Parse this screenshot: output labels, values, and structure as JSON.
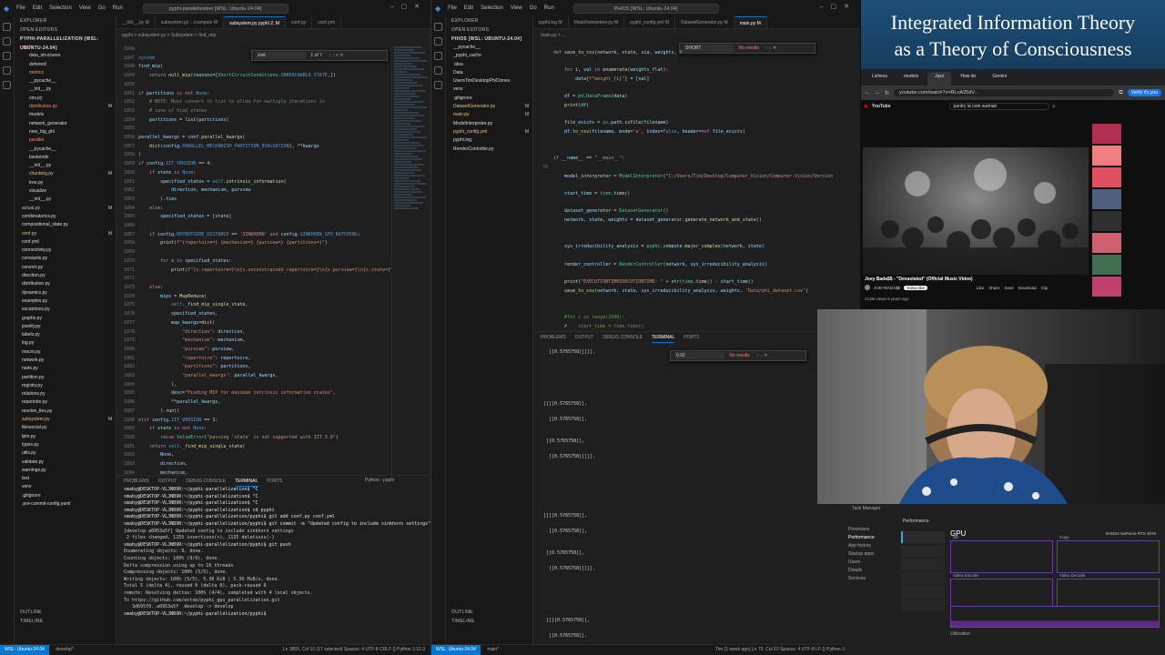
{
  "left_vscode": {
    "menu": [
      "File",
      "Edit",
      "Selection",
      "View",
      "Go",
      "Run"
    ],
    "command_center": "pyphi-parallelization [WSL: Ubuntu-24.04]",
    "explorer_title": "EXPLORER",
    "open_editors": "OPEN EDITORS",
    "root": "PYPHI-PARALLELIZATION [WSL: UBUNTU-24.04]",
    "tree": [
      {
        "name": "pyphi",
        "status": "",
        "cls": "red"
      },
      {
        "name": "data_structures",
        "status": "",
        "cls": ""
      },
      {
        "name": "deferred",
        "status": "",
        "cls": ""
      },
      {
        "name": "metrics",
        "status": "",
        "cls": "red"
      },
      {
        "name": "__pycache__",
        "status": "",
        "cls": ""
      },
      {
        "name": "__init__.py",
        "status": "",
        "cls": ""
      },
      {
        "name": "ces.py",
        "status": "",
        "cls": ""
      },
      {
        "name": "distribution.py",
        "status": "M",
        "cls": "red"
      },
      {
        "name": "models",
        "status": "",
        "cls": ""
      },
      {
        "name": "network_generator",
        "status": "",
        "cls": ""
      },
      {
        "name": "new_big_phi",
        "status": "",
        "cls": ""
      },
      {
        "name": "parallel",
        "status": "",
        "cls": "red"
      },
      {
        "name": "__pycache__",
        "status": "",
        "cls": ""
      },
      {
        "name": "backends",
        "status": "",
        "cls": ""
      },
      {
        "name": "__init__.py",
        "status": "",
        "cls": ""
      },
      {
        "name": "chunking.py",
        "status": "M",
        "cls": "mod"
      },
      {
        "name": "tree.py",
        "status": "",
        "cls": ""
      },
      {
        "name": "visualize",
        "status": "",
        "cls": ""
      },
      {
        "name": "__init__.py",
        "status": "",
        "cls": ""
      },
      {
        "name": "actual.py",
        "status": "M",
        "cls": "mod"
      },
      {
        "name": "combinatorics.py",
        "status": "",
        "cls": ""
      },
      {
        "name": "compositional_state.py",
        "status": "",
        "cls": ""
      },
      {
        "name": "conf.py",
        "status": "M",
        "cls": "mod"
      },
      {
        "name": "conf.yml",
        "status": "",
        "cls": ""
      },
      {
        "name": "connectivity.py",
        "status": "",
        "cls": ""
      },
      {
        "name": "constants.py",
        "status": "",
        "cls": ""
      },
      {
        "name": "convert.py",
        "status": "",
        "cls": ""
      },
      {
        "name": "direction.py",
        "status": "",
        "cls": ""
      },
      {
        "name": "distribution.py",
        "status": "",
        "cls": ""
      },
      {
        "name": "dynamics.py",
        "status": "",
        "cls": ""
      },
      {
        "name": "examples.py",
        "status": "",
        "cls": ""
      },
      {
        "name": "exceptions.py",
        "status": "",
        "cls": ""
      },
      {
        "name": "graphs.py",
        "status": "",
        "cls": ""
      },
      {
        "name": "jsonify.py",
        "status": "",
        "cls": ""
      },
      {
        "name": "labels.py",
        "status": "",
        "cls": ""
      },
      {
        "name": "log.py",
        "status": "",
        "cls": ""
      },
      {
        "name": "macro.py",
        "status": "",
        "cls": ""
      },
      {
        "name": "network.py",
        "status": "",
        "cls": ""
      },
      {
        "name": "node.py",
        "status": "",
        "cls": ""
      },
      {
        "name": "partition.py",
        "status": "",
        "cls": ""
      },
      {
        "name": "registry.py",
        "status": "",
        "cls": ""
      },
      {
        "name": "relations.py",
        "status": "",
        "cls": ""
      },
      {
        "name": "repertoire.py",
        "status": "",
        "cls": ""
      },
      {
        "name": "resolve_ties.py",
        "status": "",
        "cls": ""
      },
      {
        "name": "subsystem.py",
        "status": "M",
        "cls": "mod"
      },
      {
        "name": "tbinsocial.py",
        "status": "",
        "cls": ""
      },
      {
        "name": "tpm.py",
        "status": "",
        "cls": ""
      },
      {
        "name": "types.py",
        "status": "",
        "cls": ""
      },
      {
        "name": "utils.py",
        "status": "",
        "cls": ""
      },
      {
        "name": "validate.py",
        "status": "",
        "cls": ""
      },
      {
        "name": "warnings.py",
        "status": "",
        "cls": ""
      },
      {
        "name": "test",
        "status": "",
        "cls": ""
      },
      {
        "name": "venv",
        "status": "",
        "cls": ""
      },
      {
        "name": ".gitignore",
        "status": "",
        "cls": ""
      },
      {
        "name": ".pre-commit-config.yaml",
        "status": "",
        "cls": ""
      }
    ],
    "outline": "OUTLINE",
    "timeline": "TIMELINE",
    "tabs": [
      "__init__.py M",
      "subsystem.py ...\\compute M",
      "subsystem.py pyphi 2, M",
      "conf.py",
      "conf.yml"
    ],
    "breadcrumb": "pyphi > subsystem.py > Subsystem > find_mip",
    "find": {
      "query": "sink",
      "result": "1 of 7"
    },
    "line_numbers": [
      "1846",
      "1847",
      "1848",
      "1849",
      "1850",
      "1851",
      "1852",
      "1853",
      "1854",
      "1855",
      "1856",
      "1857",
      "1858",
      "1859",
      "1860",
      "1861",
      "1862",
      "1863",
      "1864",
      "1865",
      "1866",
      "1867",
      "1868",
      "1869",
      "1870",
      "1871",
      "1872",
      "1873",
      "1874",
      "1875",
      "1876",
      "1877",
      "1878",
      "1879",
      "1880",
      "1881",
      "1882",
      "1883",
      "1884",
      "1885",
      "1886",
      "1887",
      "1888",
      "1889",
      "1890",
      "1891",
      "1892",
      "1893",
      "1894"
    ],
    "panel_tabs": [
      "PROBLEMS",
      "OUTPUT",
      "DEBUG CONSOLE",
      "TERMINAL",
      "PORTS"
    ],
    "terminal_label": "Python - pyphi",
    "terminal_lines": [
      "smaby@DESKTOP-VLJNB9R:~/pyphi-parallelization$ ^C",
      "smaby@DESKTOP-VLJNB9R:~/pyphi-parallelization$ ^C",
      "smaby@DESKTOP-VLJNB9R:~/pyphi-parallelization$ ^C",
      "smaby@DESKTOP-VLJNB9R:~/pyphi-parallelization$ cd pyphi",
      "smaby@DESKTOP-VLJNB9R:~/pyphi-parallelization/pyphi$ git add conf.py conf.yml",
      "smaby@DESKTOP-VLJNB9R:~/pyphi-parallelization/pyphi$ git commit -m \"Updated config to include sinkhorn settings\"",
      "[develop a0953a5f] Updated config to include sinkhorn settings",
      " 2 files changed, 1255 insertions(+), 1135 deletions(-)",
      "smaby@DESKTOP-VLJNB9R:~/pyphi-parallelization/pyphi$ git push",
      "Enumerating objects: 9, done.",
      "Counting objects: 100% (9/9), done.",
      "Delta compression using up to 16 threads",
      "Compressing objects: 100% (5/5), done.",
      "Writing objects: 100% (5/5), 5.36 KiB | 5.36 MiB/s, done.",
      "Total 5 (delta 4), reused 0 (delta 0), pack-reused 0",
      "remote: Resolving deltas: 100% (4/4), completed with 4 local objects.",
      "To https://github.com/ectsm/pyphi_gpu_parallelization.git",
      "   3d695f0..a0953a5f  develop -> develop",
      "smaby@DESKTOP-VLJNB9R:~/pyphi-parallelization/pyphi$ "
    ],
    "status": {
      "remote": "WSL: Ubuntu-24.04",
      "branch": "develop*",
      "right": "Ln 1855, Col 10 (17 selected)   Spaces: 4   UTF-8   CRLF   {} Python   3.12.3"
    }
  },
  "right_vscode": {
    "menu": [
      "File",
      "Edit",
      "Selection",
      "View",
      "Go",
      "Run"
    ],
    "command_center": "PHIOS [WSL: Ubuntu-24.04]",
    "explorer_title": "EXPLORER",
    "open_editors": "OPEN EDITORS",
    "root": "PHIOS [WSL: UBUNTU-24.04]",
    "tree": [
      {
        "name": "__pycache__",
        "status": "",
        "cls": ""
      },
      {
        "name": "_pyphi_cache",
        "status": "",
        "cls": ""
      },
      {
        "name": ".idea",
        "status": "",
        "cls": ""
      },
      {
        "name": "Data",
        "status": "",
        "cls": ""
      },
      {
        "name": "UsersTimDesktopPhiClones",
        "status": "",
        "cls": ""
      },
      {
        "name": "venv",
        "status": "",
        "cls": ""
      },
      {
        "name": ".gitignore",
        "status": "",
        "cls": ""
      },
      {
        "name": "DatasetGenerator.py",
        "status": "M",
        "cls": "mod"
      },
      {
        "name": "main.py",
        "status": "M",
        "cls": "mod"
      },
      {
        "name": "ModelInterpreter.py",
        "status": "",
        "cls": ""
      },
      {
        "name": "pyphi_config.yml",
        "status": "M",
        "cls": "mod"
      },
      {
        "name": "pyphi.log",
        "status": "",
        "cls": ""
      },
      {
        "name": "RenderController.py",
        "status": "",
        "cls": ""
      }
    ],
    "outline": "OUTLINE",
    "timeline": "TIMELINE",
    "tabs": [
      "pyphi.log M",
      "ModelInterpreter.py M",
      "pyphi_config.yml M",
      "DatasetGenerator.py M",
      "main.py M"
    ],
    "breadcrumb": "main.py > ...",
    "find": {
      "query": "SHORT",
      "result": "No results"
    },
    "line_numbers": [
      "",
      "",
      "",
      "",
      "",
      "",
      "",
      "",
      "",
      "",
      "",
      "",
      "",
      "",
      "70",
      "",
      "",
      "",
      "",
      "",
      "",
      "",
      "",
      "",
      "",
      "",
      "",
      "",
      "",
      "",
      "",
      "",
      "",
      ""
    ],
    "panel_tabs": [
      "PROBLEMS",
      "OUTPUT",
      "DEBUG CONSOLE",
      "TERMINAL",
      "PORTS"
    ],
    "terminal_find": {
      "query": "0.92",
      "result": "No results"
    },
    "terminal_lines": [
      "   [[0.5765758]]]]],",
      "",
      "",
      "",
      "",
      "",
      "",
      " [[[[0.5765758]],",
      "",
      "   [[0.5765758]],",
      "",
      "",
      "  [[0.5765758]],",
      "",
      "   [[0.5765758]]]]],",
      "",
      "",
      "",
      "",
      "",
      "",
      "",
      " [[[[0.5765758]],",
      "",
      "   [[0.5765758]],",
      "",
      "",
      "  [[0.5765758]],",
      "",
      "   [[0.5765758]]]]],",
      "",
      "",
      "",
      "",
      "",
      "",
      "  [[[[0.5765758]],",
      "",
      "   [[0.5765758]],"
    ],
    "status": {
      "remote": "WSL: Ubuntu-24.04",
      "branch": "main*",
      "right": "Tim (1 week ago)   Ln 70, Col 63   Spaces: 4   UTF-8   LF   {} Python   3.12.3"
    }
  },
  "video_title": {
    "line1": "Integrated Information Theory",
    "line2": "as a Theory of Consciousness"
  },
  "browser": {
    "tabs": [
      "Lichess",
      "models",
      "Jazz",
      "How do",
      "Gemini"
    ],
    "url": "youtube.com/watch?v=RLnA25dV...",
    "verify": "Verify it's you",
    "search": "pantry la com suenan",
    "video_caption": "Joey Bada$$ - \"Devastated\" (Official Music Video)",
    "channel": "JOEYBADA$$",
    "subscribe": "Subscribe",
    "views": "213M views 9 years ago",
    "actions": [
      "Like",
      "Share",
      "Save",
      "Download",
      "Clip"
    ]
  },
  "taskmgr": {
    "title": "Task Manager",
    "section": "Performance",
    "sidebar": [
      "Processes",
      "Performance",
      "App history",
      "Startup apps",
      "Users",
      "Details",
      "Services"
    ],
    "gpu_label": "GPU",
    "gpu_name": "NVIDIA GeForce RTX 4070",
    "graphs": [
      "3D",
      "Copy",
      "Video Encode",
      "Video Decode"
    ],
    "utilization": "Utilization"
  },
  "colors": {
    "accent": "#0078d4",
    "editor_bg": "#1f1f1f",
    "side_bg": "#181818",
    "title_bg": "#1a4a6e"
  }
}
